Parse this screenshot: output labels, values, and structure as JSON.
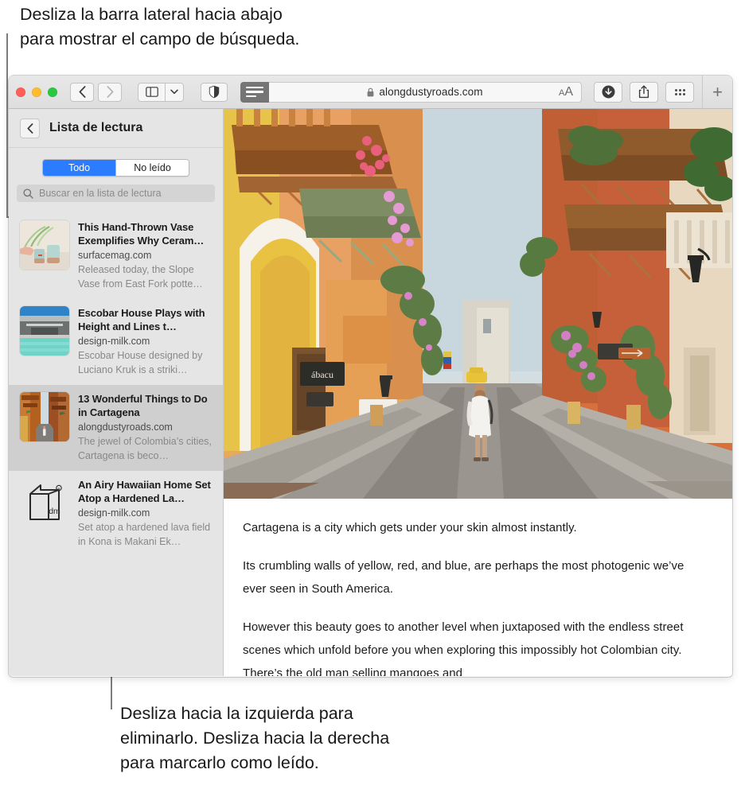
{
  "annotations": {
    "top": "Desliza la barra lateral hacia abajo\npara mostrar el campo de búsqueda.",
    "bottom": "Desliza hacia la izquierda para\neliminarlo. Desliza hacia la derecha\npara marcarlo como leído."
  },
  "window": {
    "toolbar": {
      "back_icon": "chevron-left-icon",
      "forward_icon": "chevron-right-icon",
      "sidebar_icon": "sidebar-icon",
      "sidebar_menu_icon": "chevron-down-icon",
      "privacy_icon": "shield-icon",
      "reader_icon": "reader-view-icon",
      "lock_icon": "lock-icon",
      "url": "alongdustyroads.com",
      "font_size_small": "A",
      "font_size_large": "A",
      "downloads_icon": "download-icon",
      "share_icon": "share-icon",
      "tab_overview_icon": "tab-overview-icon",
      "new_tab_label": "+"
    }
  },
  "sidebar": {
    "title": "Lista de lectura",
    "back_icon": "chevron-left-icon",
    "segments": [
      {
        "label": "Todo",
        "active": true
      },
      {
        "label": "No leído",
        "active": false
      }
    ],
    "search": {
      "icon": "search-icon",
      "placeholder": "Buscar en la lista de lectura",
      "value": ""
    },
    "items": [
      {
        "title": "This Hand-Thrown Vase Exemplifies Why Ceram…",
        "site": "surfacemag.com",
        "snippet": "Released today, the Slope Vase from East Fork potte…",
        "thumb": "vase-thumbnail",
        "selected": false
      },
      {
        "title": "Escobar House Plays with Height and Lines t…",
        "site": "design-milk.com",
        "snippet": "Escobar House designed by Luciano Kruk is a striki…",
        "thumb": "house-pool-thumbnail",
        "selected": false
      },
      {
        "title": "13 Wonderful Things to Do in Cartagena",
        "site": "alongdustyroads.com",
        "snippet": "The jewel of Colombia’s cities, Cartagena is beco…",
        "thumb": "cartagena-street-thumbnail",
        "selected": true
      },
      {
        "title": "An Airy Hawaiian Home Set Atop a Hardened La…",
        "site": "design-milk.com",
        "snippet": "Set atop a hardened lava field in Kona is Makani Ek…",
        "thumb": "design-milk-logo-thumbnail",
        "selected": false
      }
    ]
  },
  "content": {
    "hero_image": "cartagena-colonial-street-photo",
    "paragraphs": [
      "Cartagena is a city which gets under your skin almost instantly.",
      "Its crumbling walls of yellow, red, and blue, are perhaps the most photogenic we’ve ever seen in South America.",
      "However this beauty goes to another level when juxtaposed with the endless street scenes which unfold before you when exploring this impossibly hot Colombian city. There’s the old man selling mangoes and"
    ]
  },
  "colors": {
    "accent": "#2b7cff",
    "sidebar_bg": "#e5e5e5",
    "selected_row": "#cfcfcf",
    "toolbar_bg": "#e3e3e3",
    "reader_active": "#757575"
  }
}
